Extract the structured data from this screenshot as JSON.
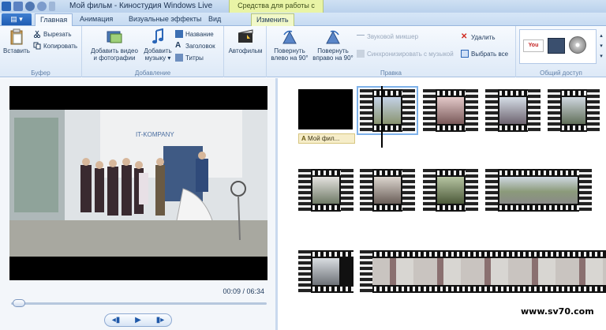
{
  "window": {
    "title": "Мой фильм - Киностудия Windows Live",
    "contextual_group": "Средства для работы с видео"
  },
  "tabs": [
    {
      "label": "Главная",
      "active": true
    },
    {
      "label": "Анимация"
    },
    {
      "label": "Визуальные эффекты"
    },
    {
      "label": "Вид"
    },
    {
      "label": "Изменить",
      "contextual": true
    }
  ],
  "ribbon": {
    "clipboard": {
      "label": "Буфер",
      "paste": "Вставить",
      "cut": "Вырезать",
      "copy": "Копировать"
    },
    "add": {
      "label": "Добавление",
      "add_media_line1": "Добавить видео",
      "add_media_line2": "и фотографии",
      "add_music_line1": "Добавить",
      "add_music_line2": "музыку ▾",
      "title": "Название",
      "caption": "Заголовок",
      "credits": "Титры"
    },
    "automovie": "Автофильм",
    "edit": {
      "label": "Правка",
      "rotate_left_line1": "Повернуть",
      "rotate_left_line2": "влево на 90°",
      "rotate_right_line1": "Повернуть",
      "rotate_right_line2": "вправо на 90°",
      "audio_mixer": "Звуковой микшер",
      "sync_music": "Синхронизировать с музыкой",
      "delete": "Удалить",
      "select_all": "Выбрать все"
    },
    "share": {
      "label": "Общий доступ"
    }
  },
  "player": {
    "time": "00:09 / 06:34",
    "progress": 0.02
  },
  "storyboard": {
    "caption_tag": "Мой фил..."
  },
  "watermark": "www.sv70.com"
}
